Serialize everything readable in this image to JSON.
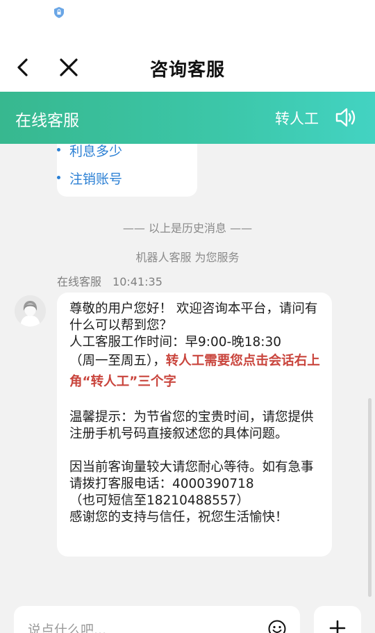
{
  "header": {
    "title": "咨询客服"
  },
  "service_bar": {
    "title": "在线客服",
    "transfer_label": "转人工"
  },
  "history_menu": {
    "items": [
      "利息多少",
      "注销账号"
    ]
  },
  "system_notes": {
    "history_divider": "—— 以上是历史消息 ——",
    "robot_service": "机器人客服 为您服务"
  },
  "message": {
    "sender": "在线客服",
    "time": "10:41:35",
    "line1": "尊敬的用户您好！ 欢迎咨询本平台，请问有什么可以帮到您？",
    "line2a": "人工客服工作时间：早9:00-晚18:30",
    "line2b": "（周一至周五），",
    "line2_red": "转人工需要您点击会话右上角“转人工”三个字",
    "line3": "温馨提示：为节省您的宝贵时间，请您提供注册手机号码直接叙述您的具体问题。",
    "line4": "因当前客询量较大请您耐心等待。如有急事请拨打客服电话：4000390718",
    "line5": "（也可短信至18210488557）",
    "line6": "感谢您的支持与信任，祝您生活愉快！"
  },
  "composer": {
    "placeholder": "说点什么吧..."
  },
  "icons": {
    "status": "lock-shield-icon",
    "back": "chevron-left-icon",
    "close": "close-icon",
    "speaker": "speaker-icon",
    "avatar": "user-avatar-icon",
    "emoji": "emoji-icon",
    "plus": "plus-icon"
  },
  "colors": {
    "accent_green": "#3cc7a9",
    "link_blue": "#2a7fd4",
    "highlight_red": "#c9453d"
  }
}
